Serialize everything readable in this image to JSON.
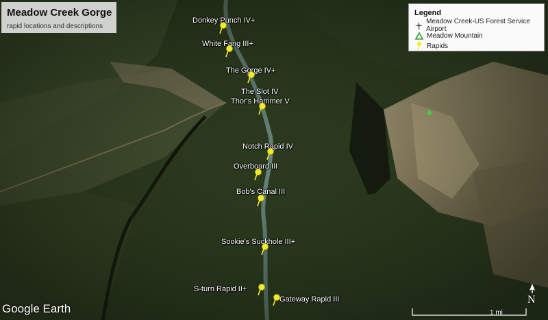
{
  "title": "Meadow Creek Gorge",
  "subtitle": "rapid locations and descriptions",
  "legend": {
    "title": "Legend",
    "items": [
      {
        "label": "Meadow Creek-US Forest Service Airport",
        "icon": "airport-icon"
      },
      {
        "label": "Meadow Mountain",
        "icon": "mountain-icon"
      },
      {
        "label": "Rapids",
        "icon": "pushpin-icon"
      }
    ]
  },
  "rapids": [
    {
      "label": "Donkey Punch IV+"
    },
    {
      "label": "White Fang III+"
    },
    {
      "label": "The Gorge IV+"
    },
    {
      "label": "The Slot IV"
    },
    {
      "label": "Thor's Hammer V"
    },
    {
      "label": "Notch Rapid IV"
    },
    {
      "label": "Overboard III"
    },
    {
      "label": "Bob's Canal III"
    },
    {
      "label": "Sookie's Suckhole III+"
    },
    {
      "label": "S-turn Rapid II+"
    },
    {
      "label": "Gateway Rapid III"
    }
  ],
  "branding": "Google Earth",
  "scale_label": "1 mi",
  "north_label": "N",
  "colors": {
    "pin": "#f3ea2a",
    "terrain_dark": "#1f2a14",
    "terrain_light": "#9b8f6e",
    "river": "#6f8f88"
  }
}
